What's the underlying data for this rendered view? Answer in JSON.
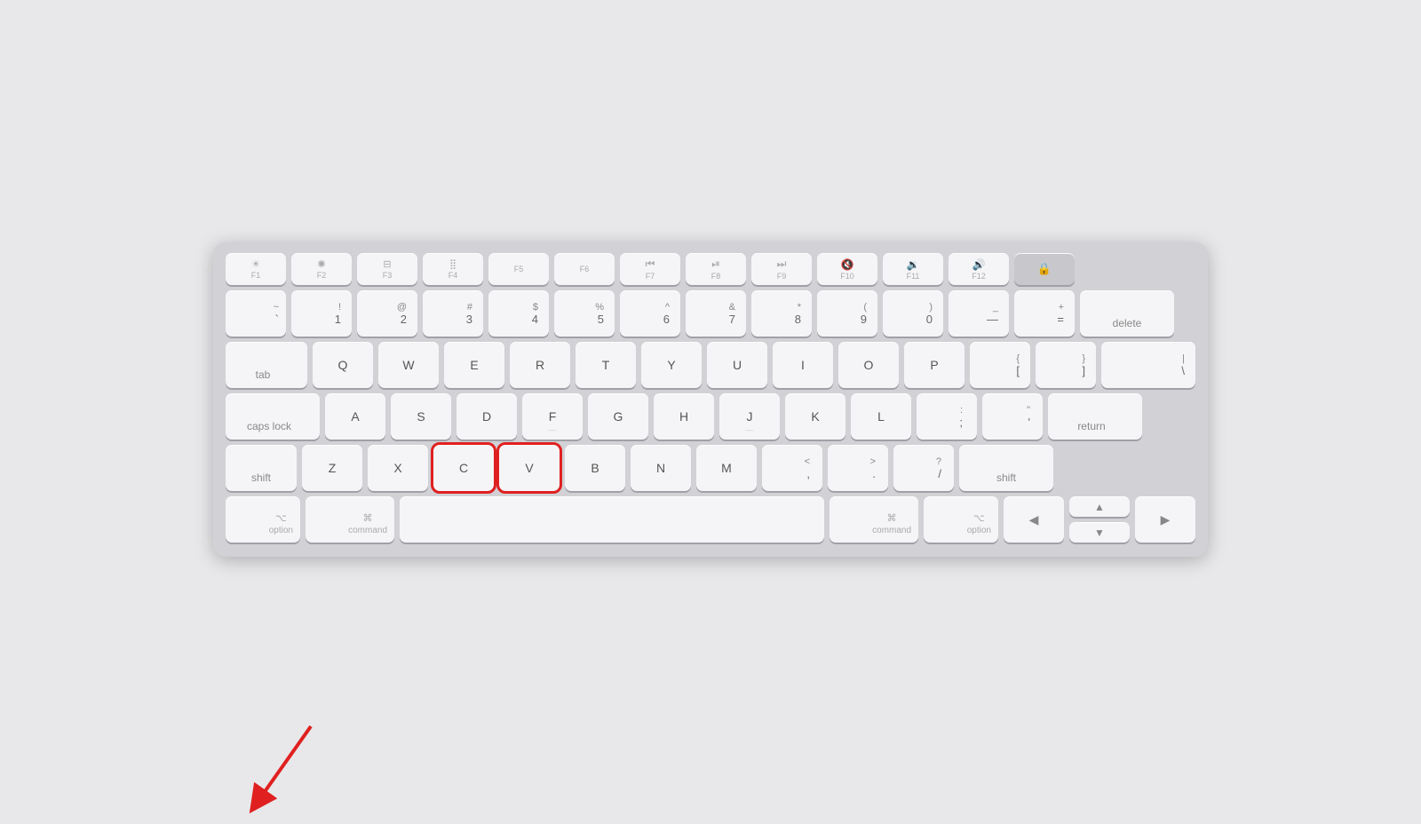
{
  "keyboard": {
    "rows": {
      "fn": {
        "keys": [
          {
            "id": "f1",
            "main": "F1",
            "top": "✦",
            "top_sym": true
          },
          {
            "id": "f2",
            "main": "F2",
            "top": "✶",
            "top_sym": true
          },
          {
            "id": "f3",
            "main": "F3",
            "top": "⊞",
            "top_sym": true
          },
          {
            "id": "f4",
            "main": "F4",
            "top": "⣿",
            "top_sym": true
          },
          {
            "id": "f5",
            "main": "F5",
            "top": ""
          },
          {
            "id": "f6",
            "main": "F6",
            "top": ""
          },
          {
            "id": "f7",
            "main": "F7",
            "top": "⏮"
          },
          {
            "id": "f8",
            "main": "F8",
            "top": "⏯"
          },
          {
            "id": "f9",
            "main": "F9",
            "top": "⏭"
          },
          {
            "id": "f10",
            "main": "F10",
            "top": "🔇"
          },
          {
            "id": "f11",
            "main": "F11",
            "top": "🔉"
          },
          {
            "id": "f12",
            "main": "F12",
            "top": "🔊"
          },
          {
            "id": "lock",
            "main": "🔒",
            "top": ""
          }
        ]
      },
      "numbers": {
        "keys": [
          {
            "id": "backtick",
            "top": "~",
            "bot": "`"
          },
          {
            "id": "1",
            "top": "!",
            "bot": "1"
          },
          {
            "id": "2",
            "top": "@",
            "bot": "2"
          },
          {
            "id": "3",
            "top": "#",
            "bot": "3"
          },
          {
            "id": "4",
            "top": "$",
            "bot": "4"
          },
          {
            "id": "5",
            "top": "%",
            "bot": "5"
          },
          {
            "id": "6",
            "top": "^",
            "bot": "6"
          },
          {
            "id": "7",
            "top": "&",
            "bot": "7"
          },
          {
            "id": "8",
            "top": "*",
            "bot": "8"
          },
          {
            "id": "9",
            "top": "(",
            "bot": "9"
          },
          {
            "id": "0",
            "top": ")",
            "bot": "0"
          },
          {
            "id": "minus",
            "top": "_",
            "bot": "—"
          },
          {
            "id": "equal",
            "top": "+",
            "bot": "="
          },
          {
            "id": "delete",
            "label": "delete"
          }
        ]
      },
      "qwer": {
        "keys": [
          {
            "id": "tab",
            "label": "tab"
          },
          {
            "id": "q",
            "main": "Q"
          },
          {
            "id": "w",
            "main": "W"
          },
          {
            "id": "e",
            "main": "E"
          },
          {
            "id": "r",
            "main": "R"
          },
          {
            "id": "t",
            "main": "T"
          },
          {
            "id": "y",
            "main": "Y"
          },
          {
            "id": "u",
            "main": "U"
          },
          {
            "id": "i",
            "main": "I"
          },
          {
            "id": "o",
            "main": "O"
          },
          {
            "id": "p",
            "main": "P"
          },
          {
            "id": "bracketl",
            "top": "{",
            "bot": "["
          },
          {
            "id": "bracketr",
            "top": "}",
            "bot": "]"
          },
          {
            "id": "backslash",
            "top": "|",
            "bot": "\\"
          }
        ]
      },
      "asdf": {
        "keys": [
          {
            "id": "caps",
            "label": "caps lock"
          },
          {
            "id": "a",
            "main": "A"
          },
          {
            "id": "s",
            "main": "S"
          },
          {
            "id": "d",
            "main": "D"
          },
          {
            "id": "f",
            "main": "F",
            "sub": "—"
          },
          {
            "id": "g",
            "main": "G"
          },
          {
            "id": "h",
            "main": "H"
          },
          {
            "id": "j",
            "main": "J",
            "sub": "—"
          },
          {
            "id": "k",
            "main": "K"
          },
          {
            "id": "l",
            "main": "L"
          },
          {
            "id": "semicolon",
            "top": ":",
            "bot": ";"
          },
          {
            "id": "quote",
            "top": "\"",
            "bot": "'"
          },
          {
            "id": "return",
            "label": "return"
          }
        ]
      },
      "zxcv": {
        "keys": [
          {
            "id": "shift-l",
            "label": "shift"
          },
          {
            "id": "z",
            "main": "Z"
          },
          {
            "id": "x",
            "main": "X"
          },
          {
            "id": "c",
            "main": "C",
            "highlighted": true
          },
          {
            "id": "v",
            "main": "V",
            "highlighted": true
          },
          {
            "id": "b",
            "main": "B"
          },
          {
            "id": "n",
            "main": "N"
          },
          {
            "id": "m",
            "main": "M"
          },
          {
            "id": "comma",
            "top": "<",
            "bot": ","
          },
          {
            "id": "period",
            "top": ">",
            "bot": "."
          },
          {
            "id": "slash",
            "top": "?",
            "bot": "/"
          },
          {
            "id": "shift-r",
            "label": "shift"
          }
        ]
      },
      "bottom": {
        "keys": [
          {
            "id": "option-l",
            "sym": "⌥",
            "label": "option"
          },
          {
            "id": "command-l",
            "sym": "⌘",
            "label": "command"
          },
          {
            "id": "space",
            "label": ""
          },
          {
            "id": "command-r",
            "sym": "⌘",
            "label": "command"
          },
          {
            "id": "option-r",
            "sym": "⌥",
            "label": "option"
          },
          {
            "id": "arrow-left",
            "sym": "◀"
          },
          {
            "id": "arrow-up",
            "sym": "▲"
          },
          {
            "id": "arrow-down",
            "sym": "▼"
          },
          {
            "id": "arrow-right",
            "sym": "▶"
          }
        ]
      }
    },
    "highlighted_keys": [
      "c",
      "v"
    ],
    "arrow_annotation": {
      "color": "#e02020"
    }
  }
}
